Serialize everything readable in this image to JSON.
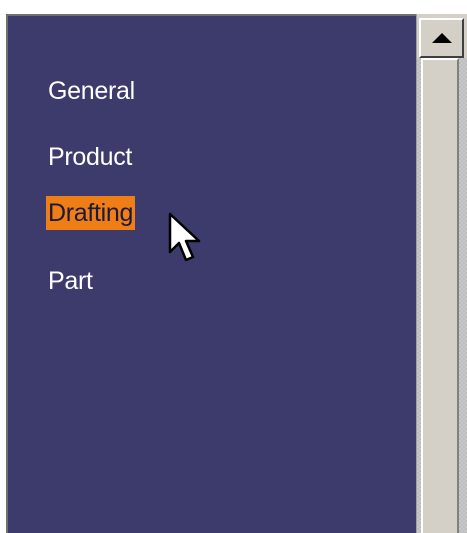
{
  "list": {
    "items": [
      {
        "label": "General",
        "selected": false
      },
      {
        "label": "Product",
        "selected": false
      },
      {
        "label": "Drafting",
        "selected": true
      },
      {
        "label": "Part",
        "selected": false
      }
    ]
  },
  "scrollbar": {
    "up_icon": "arrow-up-icon"
  },
  "cursor": {
    "icon": "mouse-pointer-icon"
  },
  "colors": {
    "panel_bg": "#3d3b6b",
    "selection_bg": "#f07e17",
    "item_text": "#ffffff",
    "scrollbar_face": "#d4d0c8"
  }
}
